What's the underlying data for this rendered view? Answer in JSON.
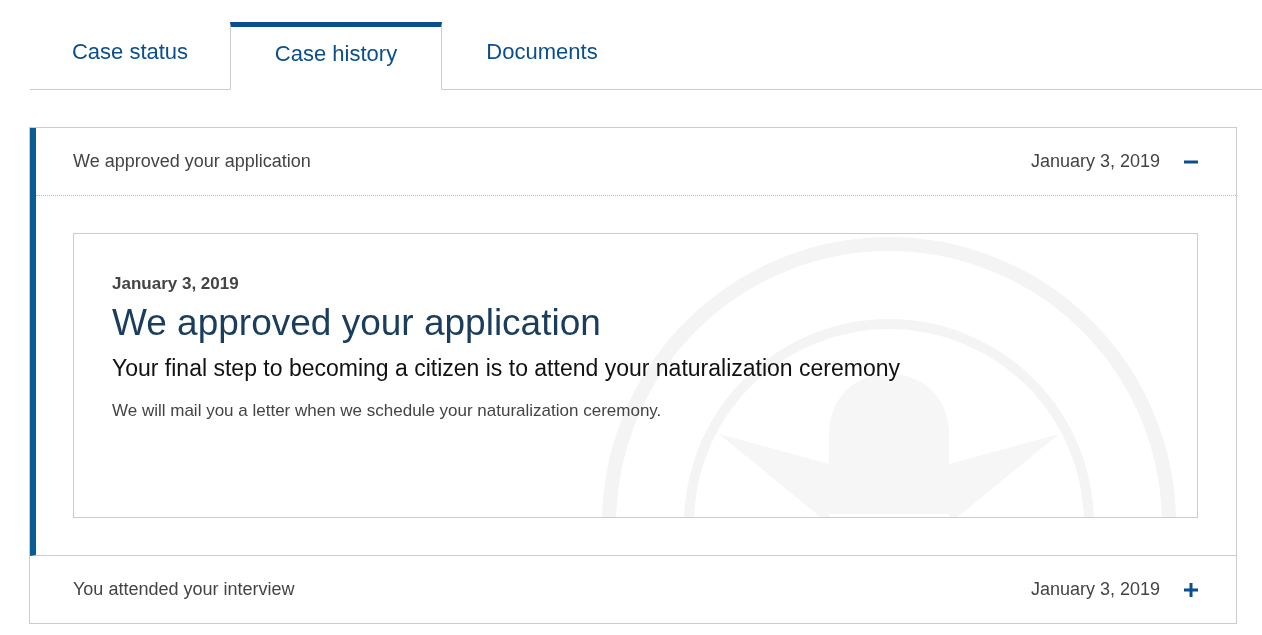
{
  "tabs": [
    {
      "label": "Case status",
      "selected": false
    },
    {
      "label": "Case history",
      "selected": true
    },
    {
      "label": "Documents",
      "selected": false
    }
  ],
  "history": [
    {
      "title": "We approved your application",
      "date": "January 3, 2019",
      "expanded": true,
      "detail": {
        "date": "January 3, 2019",
        "heading": "We approved your application",
        "subheading": "Your final step to becoming a citizen is to attend your naturalization ceremony",
        "text": "We will mail you a letter when we schedule your naturalization ceremony."
      }
    },
    {
      "title": "You attended your interview",
      "date": "January 3, 2019",
      "expanded": false
    }
  ]
}
